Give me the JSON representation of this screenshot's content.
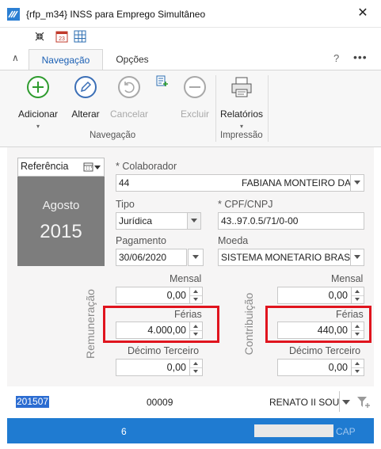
{
  "window": {
    "title": "{rfp_m34} INSS para Emprego Simultâneo",
    "close": "✕"
  },
  "quick_toolbar": {
    "collapse_icon": "collapse-arrows-icon",
    "calendar_icon": "calendar-icon",
    "grid_icon": "grid-icon"
  },
  "tabs": [
    {
      "label": "Navegação"
    },
    {
      "label": "Opções"
    }
  ],
  "tab_extras": {
    "collapse": "∧",
    "help": "?",
    "more": "•••"
  },
  "ribbon": {
    "add": "Adicionar",
    "edit": "Alterar",
    "cancel": "Cancelar",
    "delete": "Excluir",
    "reports": "Relatórios",
    "group_nav": "Navegação",
    "group_print": "Impressão"
  },
  "reference": {
    "label": "Referência",
    "month": "Agosto",
    "year": "2015"
  },
  "form": {
    "colaborador_label": "* Colaborador",
    "colaborador_code": "44",
    "colaborador_name": "FABIANA MONTEIRO DA S",
    "tipo_label": "Tipo",
    "tipo_value": "Jurídica",
    "cpf_label": "* CPF/CNPJ",
    "cpf_value": "43..97.0.5/71/0-00",
    "pagamento_label": "Pagamento",
    "pagamento_value": "30/06/2020",
    "moeda_label": "Moeda",
    "moeda_value": "SISTEMA MONETARIO BRASILE"
  },
  "remuneracao": {
    "title": "Remuneração",
    "mensal_label": "Mensal",
    "mensal_value": "0,00",
    "ferias_label": "Férias",
    "ferias_value": "4.000,00",
    "decimo_label": "Décimo Terceiro",
    "decimo_value": "0,00"
  },
  "contribuicao": {
    "title": "Contribuição",
    "mensal_label": "Mensal",
    "mensal_value": "0,00",
    "ferias_label": "Férias",
    "ferias_value": "440,00",
    "decimo_label": "Décimo Terceiro",
    "decimo_value": "0,00"
  },
  "bottom": {
    "period": "201507",
    "code": "00009",
    "name": "RENATO II SOUZA"
  },
  "status": {
    "count": "6",
    "caps": "CAP"
  },
  "colors": {
    "accent": "#1f7bd1",
    "highlight": "#e0141e",
    "ref_bg": "#7d7d7d"
  }
}
